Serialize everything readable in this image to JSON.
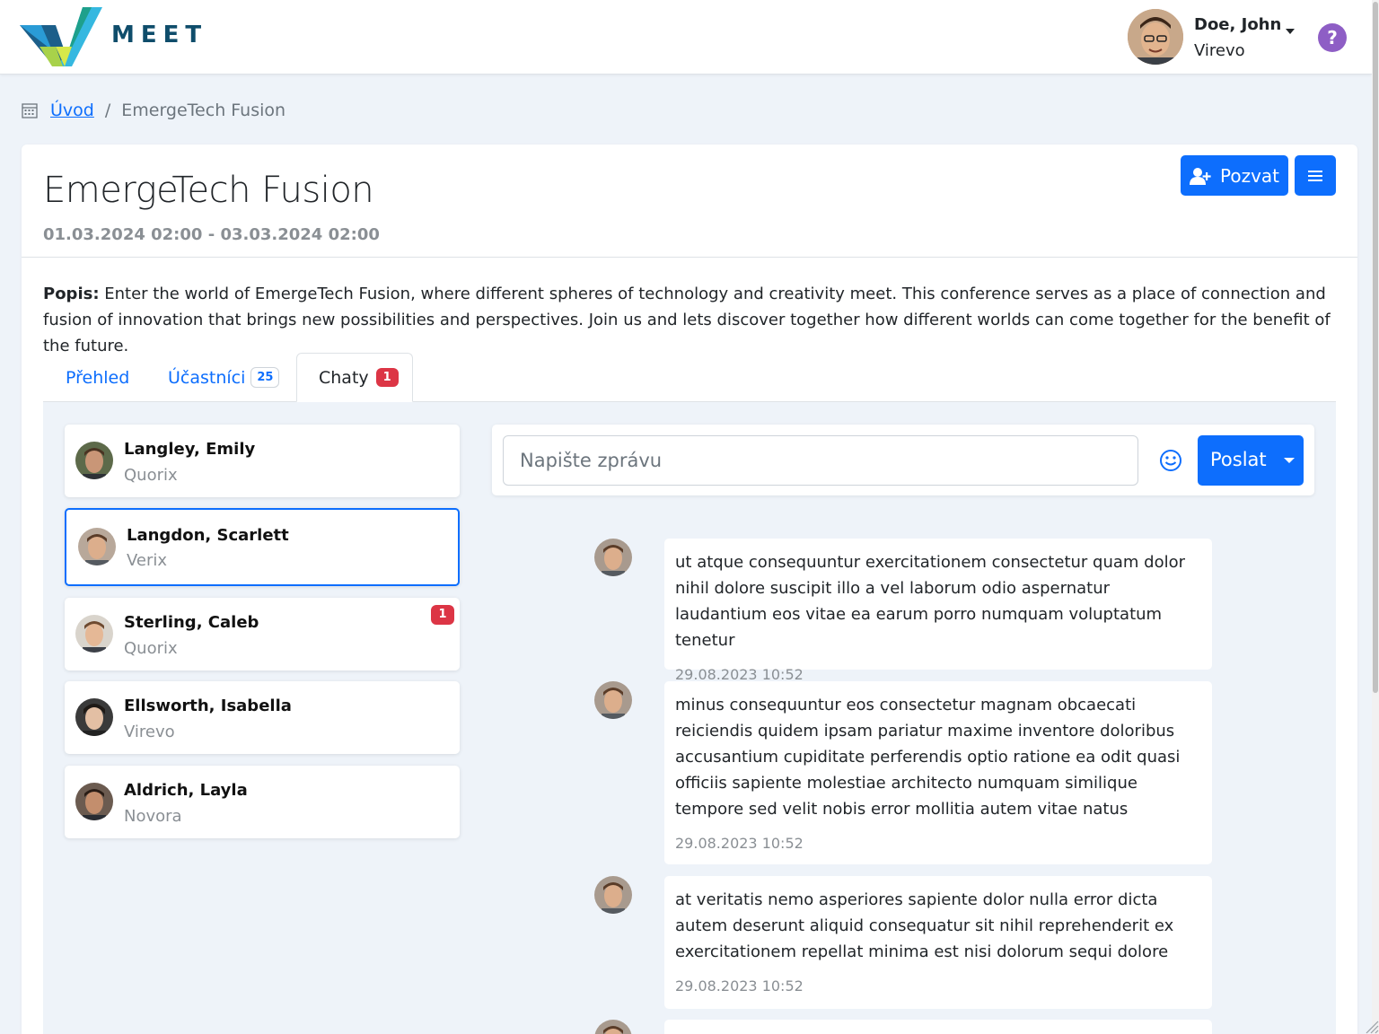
{
  "header": {
    "logo_text": "MEET",
    "user_name": "Doe, John",
    "user_org": "Virevo",
    "help_icon_text": "?"
  },
  "breadcrumb": {
    "home": "Úvod",
    "separator": "/",
    "current": "EmergeTech Fusion"
  },
  "event": {
    "title": "EmergeTech Fusion",
    "dates": "01.03.2024 02:00 - 03.03.2024 02:00",
    "invite_label": "Pozvat",
    "description_label": "Popis:",
    "description": " Enter the world of EmergeTech Fusion, where different spheres of technology and creativity meet. This conference serves as a place of connection and fusion of innovation that brings new possibilities and perspectives. Join us and lets discover together how different worlds can come together for the benefit of the future."
  },
  "tabs": [
    {
      "label": "Přehled"
    },
    {
      "label": "Účastníci",
      "badge": "25"
    },
    {
      "label": "Chaty",
      "badge": "1"
    }
  ],
  "contacts": [
    {
      "name": "Langley, Emily",
      "org": "Quorix"
    },
    {
      "name": "Langdon, Scarlett",
      "org": "Verix"
    },
    {
      "name": "Sterling, Caleb",
      "org": "Quorix",
      "badge": "1"
    },
    {
      "name": "Ellsworth, Isabella",
      "org": "Virevo"
    },
    {
      "name": "Aldrich, Layla",
      "org": "Novora"
    }
  ],
  "composer": {
    "placeholder": "Napište zprávu",
    "send_label": "Poslat"
  },
  "messages": [
    {
      "text": "ut atque consequuntur exercitationem consectetur quam dolor nihil dolore suscipit illo a vel laborum odio aspernatur laudantium eos vitae ea earum porro numquam voluptatum tenetur",
      "time": "29.08.2023 10:52"
    },
    {
      "text": "minus consequuntur eos consectetur magnam obcaecati reiciendis quidem ipsam pariatur maxime inventore doloribus accusantium cupiditate perferendis optio ratione ea odit quasi officiis sapiente molestiae architecto numquam similique tempore sed velit nobis error mollitia autem vitae natus",
      "time": "29.08.2023 10:52"
    },
    {
      "text": "at veritatis nemo asperiores sapiente dolor nulla error dicta autem deserunt aliquid consequatur sit nihil reprehenderit ex exercitationem repellat minima est nisi dolorum sequi dolore",
      "time": "29.08.2023 10:52"
    }
  ],
  "colors": {
    "primary": "#0d6efd",
    "danger": "#dc3545",
    "help": "#8e5ec5",
    "background": "#eef3f9"
  }
}
